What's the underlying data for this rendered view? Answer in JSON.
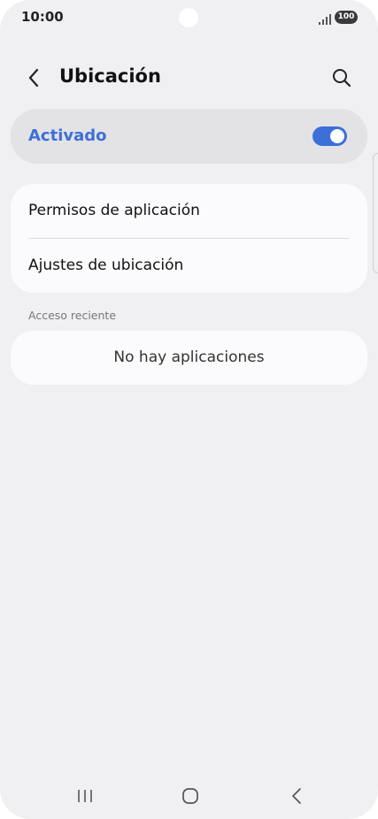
{
  "status_bar": {
    "time": "10:00",
    "battery": "100"
  },
  "header": {
    "title": "Ubicación"
  },
  "master_switch": {
    "label": "Activado",
    "state": "on",
    "accent_color": "#3d6fd9"
  },
  "settings": {
    "items": [
      {
        "label": "Permisos de aplicación"
      },
      {
        "label": "Ajustes de ubicación"
      }
    ]
  },
  "recent_access": {
    "section_title": "Acceso reciente",
    "empty_text": "No hay aplicaciones"
  },
  "icons": {
    "back": "chevron-left-icon",
    "search": "search-icon",
    "signal": "signal-icon",
    "battery": "battery-icon",
    "recents": "recents-icon",
    "home": "home-icon",
    "nav_back": "nav-back-icon"
  }
}
